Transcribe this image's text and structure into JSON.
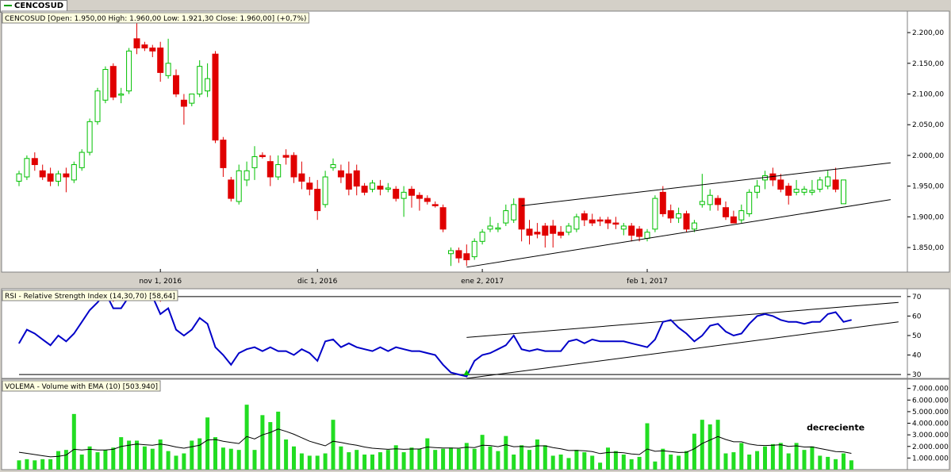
{
  "tab_label": "CENCOSUD",
  "colors": {
    "up": "#00c000",
    "down": "#e00000",
    "rsi": "#0000c8",
    "volume": "#22dd22",
    "ema": "#000000"
  },
  "chart_data": [
    {
      "type": "candlestick",
      "legend": "CENCOSUD [Open: 1.950,00   High: 1.960,00   Low: 1.921,30   Close: 1.960,00] (+0,7%)",
      "ylim": [
        1810,
        2235
      ],
      "yticks": [
        "2.200,00",
        "2.150,00",
        "2.100,00",
        "2.050,00",
        "2.000,00",
        "1.950,00",
        "1.900,00",
        "1.850,00"
      ],
      "ytick_values": [
        2200,
        2150,
        2100,
        2050,
        2000,
        1950,
        1900,
        1850
      ],
      "xtick_labels": [
        "nov 1, 2016",
        "dic 1, 2016",
        "ene 2, 2017",
        "feb 1, 2017"
      ],
      "xtick_index": [
        18,
        38,
        59,
        80
      ],
      "bars": [
        [
          1958,
          1975,
          1950,
          1970
        ],
        [
          1965,
          2000,
          1960,
          1995
        ],
        [
          1995,
          2005,
          1975,
          1985
        ],
        [
          1975,
          1985,
          1960,
          1965
        ],
        [
          1970,
          1980,
          1950,
          1958
        ],
        [
          1958,
          1975,
          1950,
          1970
        ],
        [
          1970,
          1980,
          1940,
          1965
        ],
        [
          1960,
          1990,
          1955,
          1985
        ],
        [
          1980,
          2010,
          1975,
          2005
        ],
        [
          2005,
          2060,
          2000,
          2055
        ],
        [
          2055,
          2110,
          2050,
          2105
        ],
        [
          2090,
          2145,
          2085,
          2140
        ],
        [
          2145,
          2150,
          2090,
          2095
        ],
        [
          2100,
          2110,
          2085,
          2100
        ],
        [
          2105,
          2175,
          2100,
          2170
        ],
        [
          2190,
          2220,
          2165,
          2175
        ],
        [
          2180,
          2185,
          2170,
          2175
        ],
        [
          2175,
          2180,
          2160,
          2170
        ],
        [
          2175,
          2185,
          2120,
          2135
        ],
        [
          2130,
          2190,
          2125,
          2150
        ],
        [
          2130,
          2140,
          2095,
          2100
        ],
        [
          2090,
          2100,
          2050,
          2080
        ],
        [
          2085,
          2100,
          2080,
          2100
        ],
        [
          2100,
          2155,
          2095,
          2145
        ],
        [
          2105,
          2150,
          2095,
          2125
        ],
        [
          2165,
          2170,
          2020,
          2025
        ],
        [
          2025,
          2030,
          1965,
          1980
        ],
        [
          1960,
          1965,
          1925,
          1930
        ],
        [
          1925,
          1985,
          1920,
          1975
        ],
        [
          1960,
          1990,
          1950,
          1975
        ],
        [
          1980,
          2015,
          1960,
          1998
        ],
        [
          2000,
          2005,
          1995,
          1998
        ],
        [
          1990,
          2000,
          1950,
          1965
        ],
        [
          1965,
          2000,
          1960,
          1985
        ],
        [
          2000,
          2010,
          1985,
          1997
        ],
        [
          2000,
          2005,
          1955,
          1965
        ],
        [
          1970,
          1990,
          1945,
          1958
        ],
        [
          1955,
          1965,
          1935,
          1945
        ],
        [
          1945,
          1960,
          1895,
          1910
        ],
        [
          1920,
          1975,
          1915,
          1965
        ],
        [
          1980,
          1995,
          1975,
          1985
        ],
        [
          1975,
          1985,
          1955,
          1965
        ],
        [
          1970,
          1990,
          1935,
          1945
        ],
        [
          1975,
          1985,
          1935,
          1950
        ],
        [
          1950,
          1955,
          1935,
          1940
        ],
        [
          1945,
          1960,
          1940,
          1955
        ],
        [
          1950,
          1960,
          1935,
          1945
        ],
        [
          1945,
          1955,
          1940,
          1947
        ],
        [
          1945,
          1950,
          1925,
          1930
        ],
        [
          1930,
          1950,
          1900,
          1940
        ],
        [
          1945,
          1950,
          1915,
          1935
        ],
        [
          1935,
          1940,
          1910,
          1930
        ],
        [
          1930,
          1935,
          1920,
          1925
        ],
        [
          1920,
          1925,
          1915,
          1918
        ],
        [
          1915,
          1920,
          1875,
          1880
        ],
        [
          1840,
          1850,
          1820,
          1845
        ],
        [
          1845,
          1850,
          1825,
          1833
        ],
        [
          1840,
          1855,
          1820,
          1830
        ],
        [
          1835,
          1865,
          1830,
          1860
        ],
        [
          1860,
          1880,
          1855,
          1875
        ],
        [
          1880,
          1900,
          1875,
          1885
        ],
        [
          1880,
          1890,
          1875,
          1882
        ],
        [
          1890,
          1920,
          1885,
          1910
        ],
        [
          1895,
          1930,
          1890,
          1920
        ],
        [
          1930,
          1930,
          1860,
          1880
        ],
        [
          1880,
          1895,
          1855,
          1870
        ],
        [
          1875,
          1890,
          1865,
          1872
        ],
        [
          1885,
          1890,
          1850,
          1870
        ],
        [
          1885,
          1895,
          1850,
          1873
        ],
        [
          1875,
          1885,
          1865,
          1870
        ],
        [
          1875,
          1890,
          1870,
          1885
        ],
        [
          1880,
          1905,
          1875,
          1900
        ],
        [
          1905,
          1910,
          1885,
          1895
        ],
        [
          1895,
          1905,
          1885,
          1890
        ],
        [
          1895,
          1900,
          1885,
          1893
        ],
        [
          1895,
          1900,
          1880,
          1890
        ],
        [
          1890,
          1900,
          1880,
          1888
        ],
        [
          1880,
          1890,
          1870,
          1885
        ],
        [
          1885,
          1890,
          1860,
          1870
        ],
        [
          1880,
          1885,
          1860,
          1868
        ],
        [
          1865,
          1880,
          1860,
          1875
        ],
        [
          1880,
          1935,
          1875,
          1930
        ],
        [
          1940,
          1950,
          1900,
          1905
        ],
        [
          1910,
          1920,
          1890,
          1898
        ],
        [
          1898,
          1915,
          1890,
          1905
        ],
        [
          1905,
          1910,
          1875,
          1880
        ],
        [
          1880,
          1895,
          1875,
          1890
        ],
        [
          1920,
          1970,
          1915,
          1925
        ],
        [
          1920,
          1945,
          1910,
          1935
        ],
        [
          1930,
          1935,
          1910,
          1920
        ],
        [
          1915,
          1925,
          1895,
          1900
        ],
        [
          1900,
          1910,
          1890,
          1890
        ],
        [
          1895,
          1920,
          1890,
          1910
        ],
        [
          1905,
          1945,
          1900,
          1940
        ],
        [
          1940,
          1960,
          1930,
          1950
        ],
        [
          1960,
          1975,
          1945,
          1967
        ],
        [
          1970,
          1980,
          1950,
          1960
        ],
        [
          1960,
          1970,
          1940,
          1945
        ],
        [
          1950,
          1955,
          1920,
          1935
        ],
        [
          1940,
          1960,
          1935,
          1945
        ],
        [
          1940,
          1950,
          1935,
          1945
        ],
        [
          1940,
          1960,
          1935,
          1943
        ],
        [
          1945,
          1965,
          1940,
          1960
        ],
        [
          1950,
          1975,
          1945,
          1965
        ],
        [
          1960,
          1980,
          1940,
          1945
        ],
        [
          1921.3,
          1960,
          1921.3,
          1960
        ]
      ],
      "trendlines": [
        {
          "x": [
            64,
            111
          ],
          "y": [
            1918,
            1988
          ]
        },
        {
          "x": [
            57,
            111
          ],
          "y": [
            1818,
            1928
          ]
        }
      ]
    },
    {
      "type": "line",
      "legend": "RSI - Relative Strength Index (14,30,70) [58,64]",
      "ylim": [
        28,
        74
      ],
      "yticks": [
        "70",
        "60",
        "50",
        "40",
        "30"
      ],
      "ytick_values": [
        70,
        60,
        50,
        40,
        30
      ],
      "levels": [
        70,
        30
      ],
      "values": [
        46,
        53,
        51,
        48,
        45,
        50,
        47,
        51,
        57,
        63,
        67,
        72,
        64,
        64,
        70,
        71,
        71,
        70,
        61,
        64,
        53,
        50,
        53,
        59,
        56,
        44,
        40,
        35,
        41,
        43,
        44,
        42,
        44,
        42,
        42,
        40,
        43,
        41,
        37,
        47,
        48,
        44,
        46,
        44,
        43,
        42,
        44,
        42,
        44,
        43,
        42,
        42,
        41,
        40,
        35,
        31,
        30,
        29,
        37,
        40,
        41,
        43,
        45,
        50,
        43,
        42,
        43,
        42,
        42,
        42,
        47,
        48,
        46,
        48,
        47,
        47,
        47,
        47,
        46,
        45,
        44,
        48,
        57,
        58,
        54,
        51,
        47,
        50,
        55,
        56,
        52,
        50,
        51,
        56,
        60,
        61,
        60,
        58,
        57,
        57,
        56,
        57,
        57,
        61,
        62,
        57,
        58
      ],
      "signals": [
        {
          "index": 12,
          "level": 70,
          "kind": "sell"
        },
        {
          "index": 18,
          "level": 70,
          "kind": "sell"
        },
        {
          "index": 57,
          "level": 30,
          "kind": "buy"
        }
      ],
      "trendlines": [
        {
          "x": [
            57,
            112
          ],
          "y": [
            28,
            57
          ]
        },
        {
          "x": [
            57,
            112
          ],
          "y": [
            49,
            67
          ]
        }
      ]
    },
    {
      "type": "bar",
      "legend": "VOLEMA - Volume with EMA (10) [503.940]",
      "ylim": [
        0,
        7800000
      ],
      "yticks": [
        "7.000.000",
        "6.000.000",
        "5.000.000",
        "4.000.000",
        "3.000.000",
        "2.000.000",
        "1.000.000"
      ],
      "ytick_values": [
        7000000,
        6000000,
        5000000,
        4000000,
        3000000,
        2000000,
        1000000
      ],
      "annotation": "decreciente",
      "annotation_index": 104,
      "annotation_value": 3400000,
      "values": [
        800000,
        900000,
        800000,
        900000,
        900000,
        1600000,
        1700000,
        4800000,
        1300000,
        2000000,
        1500000,
        1700000,
        1900000,
        2800000,
        2500000,
        2500000,
        2000000,
        1800000,
        2600000,
        1600000,
        1200000,
        1400000,
        2500000,
        2700000,
        4500000,
        2800000,
        1900000,
        1800000,
        1700000,
        5600000,
        1700000,
        4700000,
        4100000,
        5000000,
        2600000,
        2000000,
        1400000,
        1200000,
        1200000,
        1400000,
        4300000,
        2000000,
        1500000,
        1700000,
        1300000,
        1300000,
        1500000,
        1700000,
        2100000,
        1500000,
        1900000,
        1800000,
        2700000,
        1700000,
        1800000,
        1900000,
        1800000,
        2300000,
        1800000,
        3000000,
        2000000,
        1600000,
        2900000,
        1300000,
        2100000,
        1700000,
        2600000,
        2100000,
        1200000,
        1300000,
        1000000,
        1700000,
        1500000,
        1200000,
        600000,
        1900000,
        1600000,
        1300000,
        900000,
        1100000,
        4000000,
        700000,
        1800000,
        1300000,
        1200000,
        1600000,
        3100000,
        4300000,
        3900000,
        4300000,
        1400000,
        1500000,
        2300000,
        1300000,
        1600000,
        2000000,
        2200000,
        2300000,
        1400000,
        2300000,
        1700000,
        2000000,
        1200000,
        1100000,
        900000,
        1400000,
        800000
      ],
      "ema": [
        1500000,
        1400000,
        1300000,
        1200000,
        1100000,
        1150000,
        1250000,
        1750000,
        1700000,
        1750000,
        1700000,
        1700000,
        1750000,
        2000000,
        2100000,
        2200000,
        2150000,
        2100000,
        2200000,
        2100000,
        1950000,
        1850000,
        1980000,
        2100000,
        2550000,
        2600000,
        2450000,
        2350000,
        2250000,
        2850000,
        2650000,
        3000000,
        3200000,
        3500000,
        3300000,
        3050000,
        2750000,
        2450000,
        2250000,
        2050000,
        2450000,
        2350000,
        2200000,
        2100000,
        1950000,
        1850000,
        1800000,
        1750000,
        1800000,
        1750000,
        1780000,
        1780000,
        1950000,
        1900000,
        1870000,
        1870000,
        1850000,
        1930000,
        1900000,
        2100000,
        2080000,
        1980000,
        2150000,
        1980000,
        2000000,
        1950000,
        2050000,
        2050000,
        1900000,
        1800000,
        1650000,
        1660000,
        1630000,
        1550000,
        1380000,
        1480000,
        1500000,
        1460000,
        1350000,
        1300000,
        1780000,
        1580000,
        1620000,
        1550000,
        1480000,
        1500000,
        1800000,
        2250000,
        2550000,
        2850000,
        2600000,
        2400000,
        2400000,
        2200000,
        2100000,
        2080000,
        2100000,
        2150000,
        2000000,
        2050000,
        1950000,
        1960000,
        1820000,
        1700000,
        1560000,
        1530000,
        1400000
      ]
    }
  ]
}
